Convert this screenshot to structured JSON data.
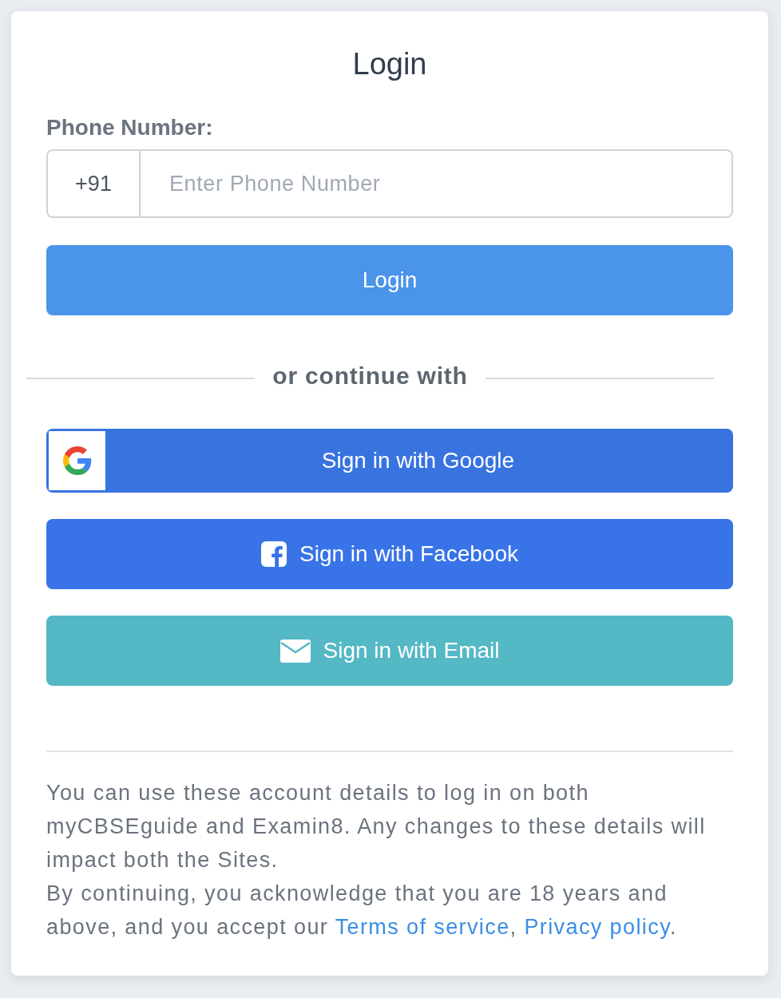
{
  "title": "Login",
  "phone": {
    "label": "Phone Number:",
    "prefix": "+91",
    "placeholder": "Enter Phone Number"
  },
  "login_button": "Login",
  "divider": "or continue with",
  "social_buttons": [
    {
      "kind": "google",
      "label": "Sign in with Google"
    },
    {
      "kind": "facebook",
      "label": "Sign in with Facebook"
    },
    {
      "kind": "email",
      "label": "Sign in with Email"
    }
  ],
  "notice": {
    "text": "You can use these account details to log in on both myCBSEguide and Examin8. Any changes to these details will impact both the Sites."
  },
  "consent": {
    "parts": [
      {
        "kind": "text",
        "text": "By continuing, you acknowledge that you are 18 years and above, and you accept our "
      },
      {
        "kind": "link",
        "text": "Terms of service"
      },
      {
        "kind": "text",
        "text": ", "
      },
      {
        "kind": "link",
        "text": "Privacy policy"
      },
      {
        "kind": "text",
        "text": "."
      }
    ]
  }
}
